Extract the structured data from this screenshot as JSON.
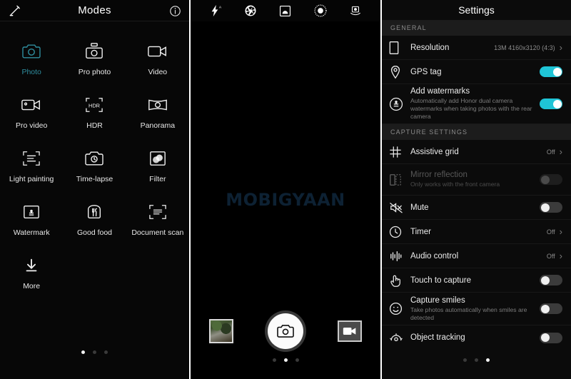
{
  "modes_panel": {
    "title": "Modes",
    "header_icons": {
      "left": "magic-wand-icon",
      "right": "info-icon"
    },
    "items": [
      {
        "label": "Photo",
        "icon": "photo-camera-icon",
        "active": true
      },
      {
        "label": "Pro photo",
        "icon": "pro-photo-icon",
        "active": false
      },
      {
        "label": "Video",
        "icon": "video-camera-icon",
        "active": false
      },
      {
        "label": "Pro video",
        "icon": "pro-video-icon",
        "active": false
      },
      {
        "label": "HDR",
        "icon": "hdr-icon",
        "active": false
      },
      {
        "label": "Panorama",
        "icon": "panorama-icon",
        "active": false
      },
      {
        "label": "Light painting",
        "icon": "light-painting-icon",
        "active": false
      },
      {
        "label": "Time-lapse",
        "icon": "time-lapse-icon",
        "active": false
      },
      {
        "label": "Filter",
        "icon": "filter-icon",
        "active": false
      },
      {
        "label": "Watermark",
        "icon": "watermark-icon",
        "active": false
      },
      {
        "label": "Good food",
        "icon": "good-food-icon",
        "active": false
      },
      {
        "label": "Document scan",
        "icon": "document-scan-icon",
        "active": false
      },
      {
        "label": "More",
        "icon": "download-more-icon",
        "active": false
      }
    ],
    "pager": {
      "count": 3,
      "active_index": 0
    }
  },
  "camera_panel": {
    "top_icons": [
      "flash-auto-icon",
      "aperture-icon",
      "wide-aperture-icon",
      "beauty-filter-icon",
      "moving-picture-icon"
    ],
    "watermark_text": "MOBIGYAAN",
    "gallery_thumbnail": "gallery-thumbnail",
    "shutter_button": "shutter-button",
    "video_button": "video-record-button",
    "pager": {
      "count": 3,
      "active_index": 1
    }
  },
  "settings_panel": {
    "title": "Settings",
    "sections": [
      {
        "header": "GENERAL",
        "rows": [
          {
            "label": "Resolution",
            "sub": "",
            "icon": "resolution-icon",
            "control": "chevron",
            "value": "13M 4160x3120 (4:3)",
            "disabled": false
          },
          {
            "label": "GPS tag",
            "sub": "",
            "icon": "location-pin-icon",
            "control": "toggle",
            "state": "on",
            "disabled": false
          },
          {
            "label": "Add watermarks",
            "sub": "Automatically add Honor dual camera watermarks when taking photos with the rear camera",
            "icon": "watermark-stamp-icon",
            "control": "toggle",
            "state": "on",
            "disabled": false
          }
        ]
      },
      {
        "header": "CAPTURE SETTINGS",
        "rows": [
          {
            "label": "Assistive grid",
            "sub": "",
            "icon": "grid-icon",
            "control": "chevron",
            "value": "Off",
            "disabled": false
          },
          {
            "label": "Mirror reflection",
            "sub": "Only works with the front camera",
            "icon": "mirror-icon",
            "control": "toggle",
            "state": "disabled",
            "disabled": true
          },
          {
            "label": "Mute",
            "sub": "",
            "icon": "mute-icon",
            "control": "toggle",
            "state": "off",
            "disabled": false
          },
          {
            "label": "Timer",
            "sub": "",
            "icon": "timer-clock-icon",
            "control": "chevron",
            "value": "Off",
            "disabled": false
          },
          {
            "label": "Audio control",
            "sub": "",
            "icon": "audio-control-icon",
            "control": "chevron",
            "value": "Off",
            "disabled": false
          },
          {
            "label": "Touch to capture",
            "sub": "",
            "icon": "touch-icon",
            "control": "toggle",
            "state": "off",
            "disabled": false
          },
          {
            "label": "Capture smiles",
            "sub": "Take photos automatically when smiles are detected",
            "icon": "smile-icon",
            "control": "toggle",
            "state": "off",
            "disabled": false
          },
          {
            "label": "Object tracking",
            "sub": "",
            "icon": "object-tracking-icon",
            "control": "toggle",
            "state": "off",
            "disabled": false
          }
        ]
      }
    ],
    "pager": {
      "count": 3,
      "active_index": 2
    }
  },
  "colors": {
    "accent_teal": "#2f8d9e",
    "toggle_on": "#1fc4d6",
    "watermark": "#0d2133",
    "background": "#000000"
  }
}
